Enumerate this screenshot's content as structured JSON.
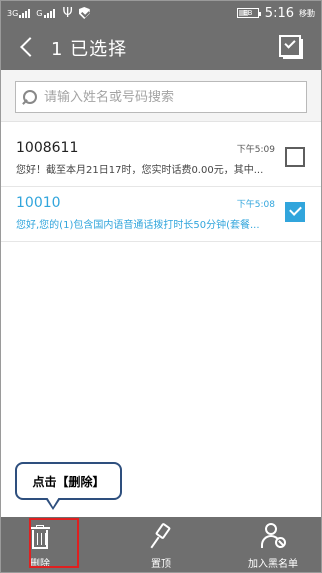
{
  "status_bar": {
    "signal_1": "3G",
    "signal_2": "G",
    "battery_text": "EB",
    "time": "5:16",
    "carrier": "移動"
  },
  "header": {
    "title": "1 已选择"
  },
  "search": {
    "placeholder": "请输入姓名或号码搜索",
    "value": ""
  },
  "messages": [
    {
      "sender": "1008611",
      "time": "下午5:09",
      "preview": "您好！截至本月21日17时，您实时话费0.00元，其中...",
      "selected": false
    },
    {
      "sender": "10010",
      "time": "下午5:08",
      "preview": "您好,您的(1)包含国内语音通话拨打时长50分钟(套餐...",
      "selected": true
    }
  ],
  "callout": {
    "text": "点击【删除】"
  },
  "bottom_bar": {
    "delete_label": "删除",
    "pin_label": "置顶",
    "blacklist_label": "加入黑名单"
  },
  "colors": {
    "bar": "#6f6f6f",
    "accent": "#31a5dc",
    "highlight": "#e02020",
    "callout_border": "#2e4f7e"
  }
}
